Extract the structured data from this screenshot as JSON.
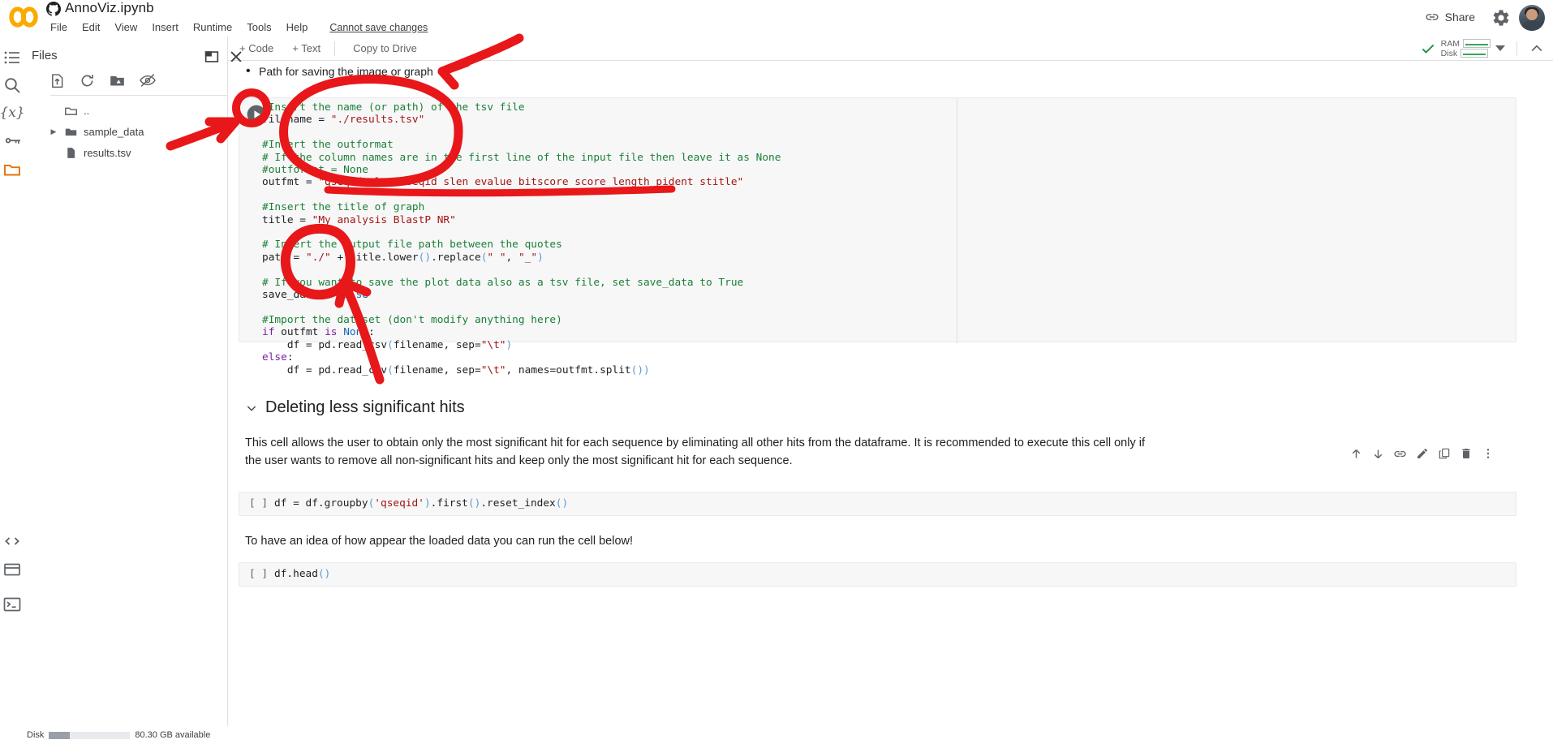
{
  "app": {
    "logo": "colab-logo",
    "github_icon": "github-icon",
    "doc_title": "AnnoViz.ipynb",
    "save_status": "Cannot save changes"
  },
  "menubar": {
    "items": [
      "File",
      "Edit",
      "View",
      "Insert",
      "Runtime",
      "Tools",
      "Help"
    ]
  },
  "header_right": {
    "link_icon": "link-icon",
    "share_label": "Share",
    "settings_icon": "gear-icon",
    "avatar": "user-avatar"
  },
  "toolbar": {
    "add_code_label": "+ Code",
    "add_text_label": "+ Text",
    "copy_to_drive_label": "Copy to Drive",
    "connected_icon": "checkmark-icon",
    "ram_label": "RAM",
    "disk_label": "Disk",
    "dropdown_icon": "caret-down-icon",
    "collapse_icon": "chevron-up-icon"
  },
  "rail": {
    "items": [
      {
        "name": "table-of-contents-icon",
        "label": "Table of contents"
      },
      {
        "name": "search-icon",
        "label": "Find and replace"
      },
      {
        "name": "variables-icon",
        "label": "Variables"
      },
      {
        "name": "secrets-key-icon",
        "label": "Secrets"
      },
      {
        "name": "files-folder-icon",
        "label": "Files"
      }
    ],
    "bottom_items": [
      {
        "name": "code-snippets-icon",
        "label": "Code snippets"
      },
      {
        "name": "command-palette-icon",
        "label": "Command palette"
      },
      {
        "name": "terminal-icon",
        "label": "Terminal"
      }
    ]
  },
  "files_panel": {
    "title": "Files",
    "open_in_new_icon": "open-in-new-icon",
    "close_icon": "close-icon",
    "tools": [
      {
        "name": "upload-icon",
        "label": "Upload to session storage"
      },
      {
        "name": "refresh-icon",
        "label": "Refresh"
      },
      {
        "name": "mount-drive-icon",
        "label": "Mount Drive"
      },
      {
        "name": "hidden-files-icon",
        "label": "Show hidden files"
      }
    ],
    "entries": [
      {
        "name": "..",
        "type": "folder-up",
        "expandable": false
      },
      {
        "name": "sample_data",
        "type": "folder",
        "expandable": true
      },
      {
        "name": "results.tsv",
        "type": "file",
        "expandable": false
      }
    ]
  },
  "notebook": {
    "bullet_text": "Path for saving the image or graph",
    "code_cell": {
      "run_icon": "run-cell-icon",
      "lines": [
        {
          "segs": [
            {
              "t": "#Insert the name (or path) of the tsv file",
              "c": "cm"
            }
          ]
        },
        {
          "segs": [
            {
              "t": "filename = ",
              "c": ""
            },
            {
              "t": "\"./results.tsv\"",
              "c": "st"
            }
          ]
        },
        {
          "segs": []
        },
        {
          "segs": [
            {
              "t": "#Insert the outformat",
              "c": "cm"
            }
          ]
        },
        {
          "segs": [
            {
              "t": "# If the column names are in the first line of the input file then leave it as None",
              "c": "cm"
            }
          ]
        },
        {
          "segs": [
            {
              "t": "#outformat = None",
              "c": "cm"
            }
          ]
        },
        {
          "segs": [
            {
              "t": "outfmt = ",
              "c": ""
            },
            {
              "t": "\"qseqid qlen sseqid slen evalue bitscore score length pident stitle\"",
              "c": "st"
            }
          ]
        },
        {
          "segs": []
        },
        {
          "segs": [
            {
              "t": "#Insert the title of graph",
              "c": "cm"
            }
          ]
        },
        {
          "segs": [
            {
              "t": "title = ",
              "c": ""
            },
            {
              "t": "\"My analysis BlastP NR\"",
              "c": "st"
            }
          ]
        },
        {
          "segs": []
        },
        {
          "segs": [
            {
              "t": "# Insert the output file path between the quotes",
              "c": "cm"
            }
          ]
        },
        {
          "segs": [
            {
              "t": "path = ",
              "c": ""
            },
            {
              "t": "\"./\"",
              "c": "st"
            },
            {
              "t": " + title.lower",
              "c": ""
            },
            {
              "t": "()",
              "c": "pn"
            },
            {
              "t": ".replace",
              "c": ""
            },
            {
              "t": "(",
              "c": "pn"
            },
            {
              "t": "\" \"",
              "c": "st"
            },
            {
              "t": ", ",
              "c": ""
            },
            {
              "t": "\"_\"",
              "c": "st"
            },
            {
              "t": ")",
              "c": "pn"
            }
          ]
        },
        {
          "segs": []
        },
        {
          "segs": [
            {
              "t": "# If you want to save the plot data also as a tsv file, set save_data to True",
              "c": "cm"
            }
          ]
        },
        {
          "segs": [
            {
              "t": "save_data = ",
              "c": ""
            },
            {
              "t": "False",
              "c": "bl"
            }
          ]
        },
        {
          "segs": []
        },
        {
          "segs": [
            {
              "t": "#Import the dataset (don't modify anything here)",
              "c": "cm"
            }
          ]
        },
        {
          "segs": [
            {
              "t": "if",
              "c": "kw"
            },
            {
              "t": " outfmt ",
              "c": ""
            },
            {
              "t": "is",
              "c": "kw"
            },
            {
              "t": " ",
              "c": ""
            },
            {
              "t": "None",
              "c": "bl"
            },
            {
              "t": ":",
              "c": ""
            }
          ]
        },
        {
          "segs": [
            {
              "t": "    df = pd.read_csv",
              "c": ""
            },
            {
              "t": "(",
              "c": "pn"
            },
            {
              "t": "filename, sep=",
              "c": ""
            },
            {
              "t": "\"\\t\"",
              "c": "st"
            },
            {
              "t": ")",
              "c": "pn"
            }
          ]
        },
        {
          "segs": [
            {
              "t": "else",
              "c": "kw"
            },
            {
              "t": ":",
              "c": ""
            }
          ]
        },
        {
          "segs": [
            {
              "t": "    df = pd.read_csv",
              "c": ""
            },
            {
              "t": "(",
              "c": "pn"
            },
            {
              "t": "filename, sep=",
              "c": ""
            },
            {
              "t": "\"\\t\"",
              "c": "st"
            },
            {
              "t": ", names=outfmt.split",
              "c": ""
            },
            {
              "t": "()",
              "c": "pn"
            },
            {
              "t": ")",
              "c": "pn"
            }
          ]
        }
      ]
    },
    "cell_toolbar": [
      {
        "name": "move-cell-up-icon",
        "label": "Move cell up"
      },
      {
        "name": "move-cell-down-icon",
        "label": "Move cell down"
      },
      {
        "name": "link-to-cell-icon",
        "label": "Link to cell"
      },
      {
        "name": "edit-cell-icon",
        "label": "Edit"
      },
      {
        "name": "copy-cell-icon",
        "label": "Copy cell"
      },
      {
        "name": "delete-cell-icon",
        "label": "Delete cell"
      },
      {
        "name": "more-options-icon",
        "label": "More cell actions"
      }
    ],
    "markdown_section": {
      "chevron": "chevron-down-icon",
      "heading": "Deleting less significant hits",
      "paragraph": "This cell allows the user to obtain only the most significant hit for each sequence by eliminating all other hits from the dataframe. It is recommended to execute this cell only if the user wants to remove all non-significant hits and keep only the most significant hit for each sequence."
    },
    "cell_groupby": {
      "prompt": "[ ]",
      "segs": [
        {
          "t": "df = df.groupby",
          "c": ""
        },
        {
          "t": "(",
          "c": "pn"
        },
        {
          "t": "'qseqid'",
          "c": "st"
        },
        {
          "t": ")",
          "c": "pn"
        },
        {
          "t": ".first",
          "c": ""
        },
        {
          "t": "()",
          "c": "pn"
        },
        {
          "t": ".reset_index",
          "c": ""
        },
        {
          "t": "()",
          "c": "pn"
        }
      ]
    },
    "mid_paragraph": "To have an idea of how appear the loaded data you can run the cell below!",
    "cell_head": {
      "prompt": "[ ]",
      "segs": [
        {
          "t": "df.head",
          "c": ""
        },
        {
          "t": "()",
          "c": "pn"
        }
      ]
    }
  },
  "status_bar": {
    "disk_label": "Disk",
    "disk_text": "80.30 GB available"
  },
  "colors": {
    "accent_orange": "#f9ab00",
    "annotation_red": "#e8171a",
    "comment_green": "#1a7f37",
    "string_red": "#a31515",
    "keyword_purple": "#7b1fa2",
    "builtin_blue": "#1565c0",
    "code_bg": "#f7f7f7",
    "text_primary": "#202124",
    "text_secondary": "#5f6368"
  }
}
